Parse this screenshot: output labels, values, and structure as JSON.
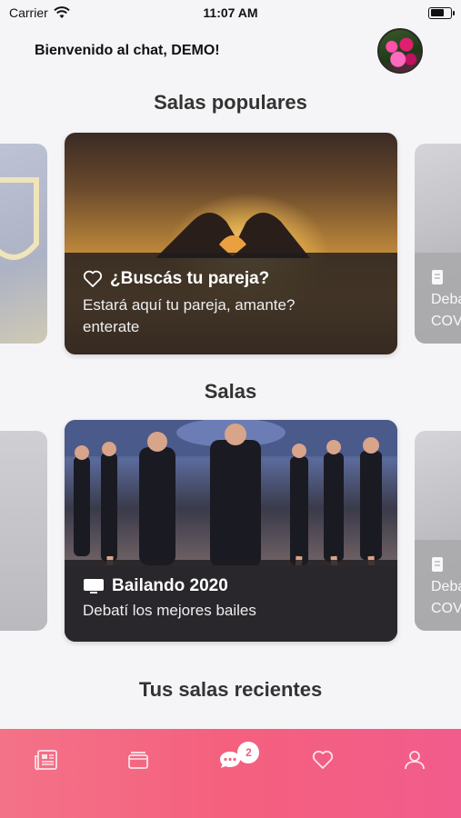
{
  "status_bar": {
    "carrier": "Carrier",
    "time": "11:07 AM",
    "battery_level": 0.7
  },
  "header": {
    "welcome": "Bienvenido al chat, DEMO!"
  },
  "popular": {
    "title": "Salas populares",
    "card": {
      "icon": "heart-outline-icon",
      "title": "¿Buscás tu pareja?",
      "desc_line1": "Estará aquí tu pareja, amante?",
      "desc_line2": "enterate"
    },
    "right_peek": {
      "icon": "document-icon",
      "line1": "Deba",
      "line2": "COV"
    }
  },
  "rooms": {
    "title": "Salas",
    "card": {
      "icon": "tv-icon",
      "title": "Bailando 2020",
      "desc": "Debatí los mejores bailes"
    },
    "right_peek": {
      "icon": "document-icon",
      "line1": "Deba",
      "line2": "COV"
    }
  },
  "recent": {
    "title": "Tus salas recientes"
  },
  "tabbar": {
    "colors": {
      "start": "#f47288",
      "end": "#f25c8c"
    },
    "tabs": [
      {
        "name": "news-icon"
      },
      {
        "name": "wallet-icon"
      },
      {
        "name": "chat-icon",
        "badge": "2"
      },
      {
        "name": "heart-icon"
      },
      {
        "name": "profile-icon"
      }
    ]
  }
}
